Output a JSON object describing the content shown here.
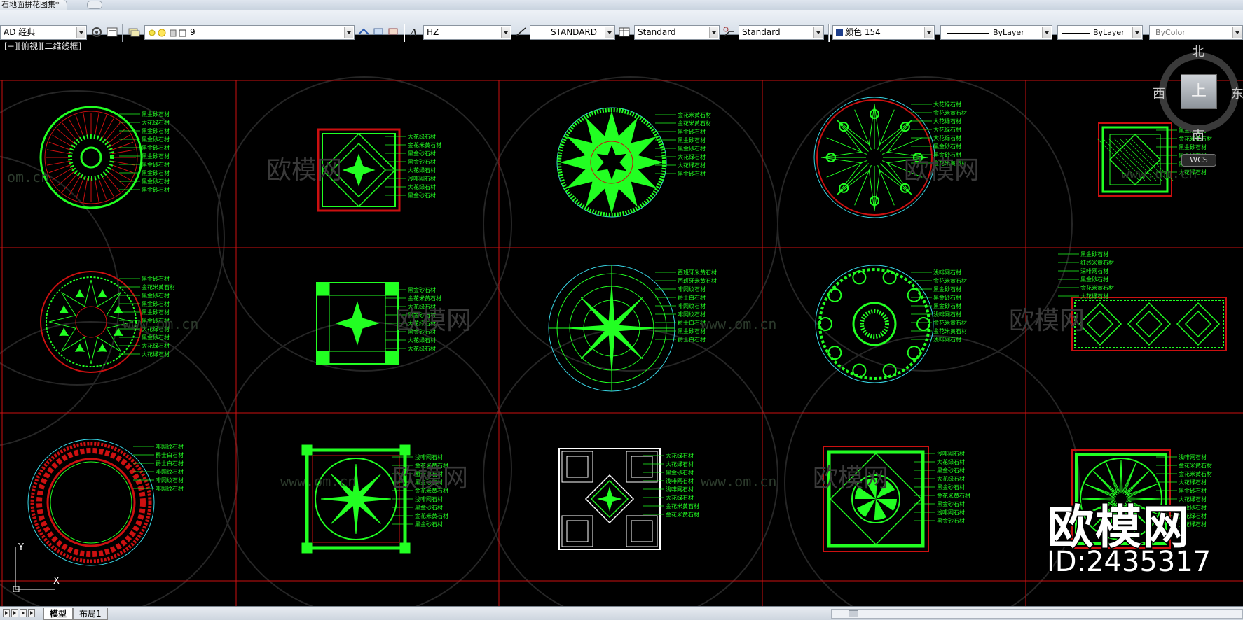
{
  "window": {
    "document_tab": "石地面拼花图集*"
  },
  "toolbar": {
    "workspace": "AD 经典",
    "layer": "9",
    "text_style": "HZ",
    "dim_style": "STANDARD",
    "table_style": "Standard",
    "mleader_style": "Standard",
    "color": "颜色 154",
    "linetype": "ByLayer",
    "lineweight": "ByLayer",
    "plotstyle": "ByColor"
  },
  "viewport": {
    "label": "[−][俯视][二维线框]"
  },
  "viewcube": {
    "north": "北",
    "south": "南",
    "east": "东",
    "west": "西",
    "top": "上",
    "wcs": "WCS"
  },
  "ucs": {
    "x": "X",
    "y": "Y"
  },
  "watermark": {
    "brand": "欧模网",
    "url": "www.om.cn",
    "url_partial": "om.cn",
    "id": "ID:2435317"
  },
  "drawings": [
    {
      "labels": [
        "黑金砂石材",
        "大花绿石材",
        "黑金砂石材",
        "黑金砂石材",
        "黑金砂石材",
        "黑金砂石材",
        "黑金砂石材",
        "黑金砂石材",
        "黑金砂石材",
        "黑金砂石材"
      ]
    },
    {
      "labels": [
        "大花绿石材",
        "金花米黄石材",
        "黑金砂石材",
        "黑金砂石材",
        "大花绿石材",
        "浅啡网石材",
        "大花绿石材",
        "黑金砂石材"
      ]
    },
    {
      "labels": [
        "金花米黄石材",
        "金花米黄石材",
        "黑金砂石材",
        "黑金砂石材",
        "黑金砂石材",
        "大花绿石材",
        "大花绿石材",
        "黑金砂石材"
      ]
    },
    {
      "labels": [
        "大花绿石材",
        "金花米黄石材",
        "大花绿石材",
        "大花绿石材",
        "大花绿石材",
        "黑金砂石材",
        "黑金砂石材",
        "金花米黄石材"
      ]
    },
    {
      "labels": [
        "黑金砂石材",
        "金花米黄石材",
        "黑金砂石材",
        "黑金砂石材",
        "黑金砂石材",
        "大花绿石材"
      ]
    },
    {
      "labels": [
        "黑金砂石材",
        "金花米黄石材",
        "黑金砂石材",
        "黑金砂石材",
        "黑金砂石材",
        "黑金砂石材",
        "大花绿石材",
        "黑金砂石材",
        "大花绿石材",
        "大花绿石材"
      ]
    },
    {
      "labels": [
        "黑金砂石材",
        "金花米黄石材",
        "大花绿石材",
        "黑金砂石材",
        "大花绿石材",
        "黑金砂石材",
        "大花绿石材",
        "大花绿石材"
      ]
    },
    {
      "labels": [
        "西班牙米黄石材",
        "西班牙米黄石材",
        "啡网纹石材",
        "爵士白石材",
        "啡网纹石材",
        "啡网纹石材",
        "爵士白石材",
        "黑金砂石材",
        "爵士白石材"
      ]
    },
    {
      "labels": [
        "浅啡网石材",
        "金花米黄石材",
        "黑金砂石材",
        "黑金砂石材",
        "黑金砂石材",
        "浅啡网石材",
        "金花米黄石材",
        "金花米黄石材",
        "浅啡网石材"
      ]
    },
    {
      "labels": [
        "黑金砂石材",
        "红线米黄石材",
        "深啡网石材",
        "黑金砂石材",
        "金花米黄石材",
        "大花绿石材"
      ]
    },
    {
      "labels": [
        "啡网纹石材",
        "爵士白石材",
        "爵士白石材",
        "啡网纹石材",
        "啡网纹石材",
        "啡网纹石材"
      ]
    },
    {
      "labels": [
        "浅啡网石材",
        "金花米黄石材",
        "爵士白石材",
        "黑金砂石材",
        "金花米黄石材",
        "浅啡网石材",
        "黑金砂石材",
        "金花米黄石材",
        "黑金砂石材"
      ]
    },
    {
      "labels": [
        "大花绿石材",
        "大花绿石材",
        "黑金砂石材",
        "浅啡网石材",
        "浅啡网石材",
        "大花绿石材",
        "金花米黄石材",
        "金花米黄石材"
      ]
    },
    {
      "labels": [
        "浅啡网石材",
        "大花绿石材",
        "黑金砂石材",
        "大花绿石材",
        "黑金砂石材",
        "金花米黄石材",
        "黑金砂石材",
        "浅啡网石材",
        "黑金砂石材"
      ]
    },
    {
      "labels": [
        "浅啡网石材",
        "金花米黄石材",
        "金花米黄石材",
        "大花绿石材",
        "黑金砂石材",
        "大花绿石材",
        "黑金砂石材",
        "大花绿石材",
        "大花绿石材"
      ]
    }
  ],
  "statusbar": {
    "tab_model": "模型",
    "tab_layout": "布局1"
  },
  "colors": {
    "cad_green": "#22ff22",
    "grid_red": "#cc1010",
    "cyan": "#39d7e6",
    "background": "#000000"
  }
}
